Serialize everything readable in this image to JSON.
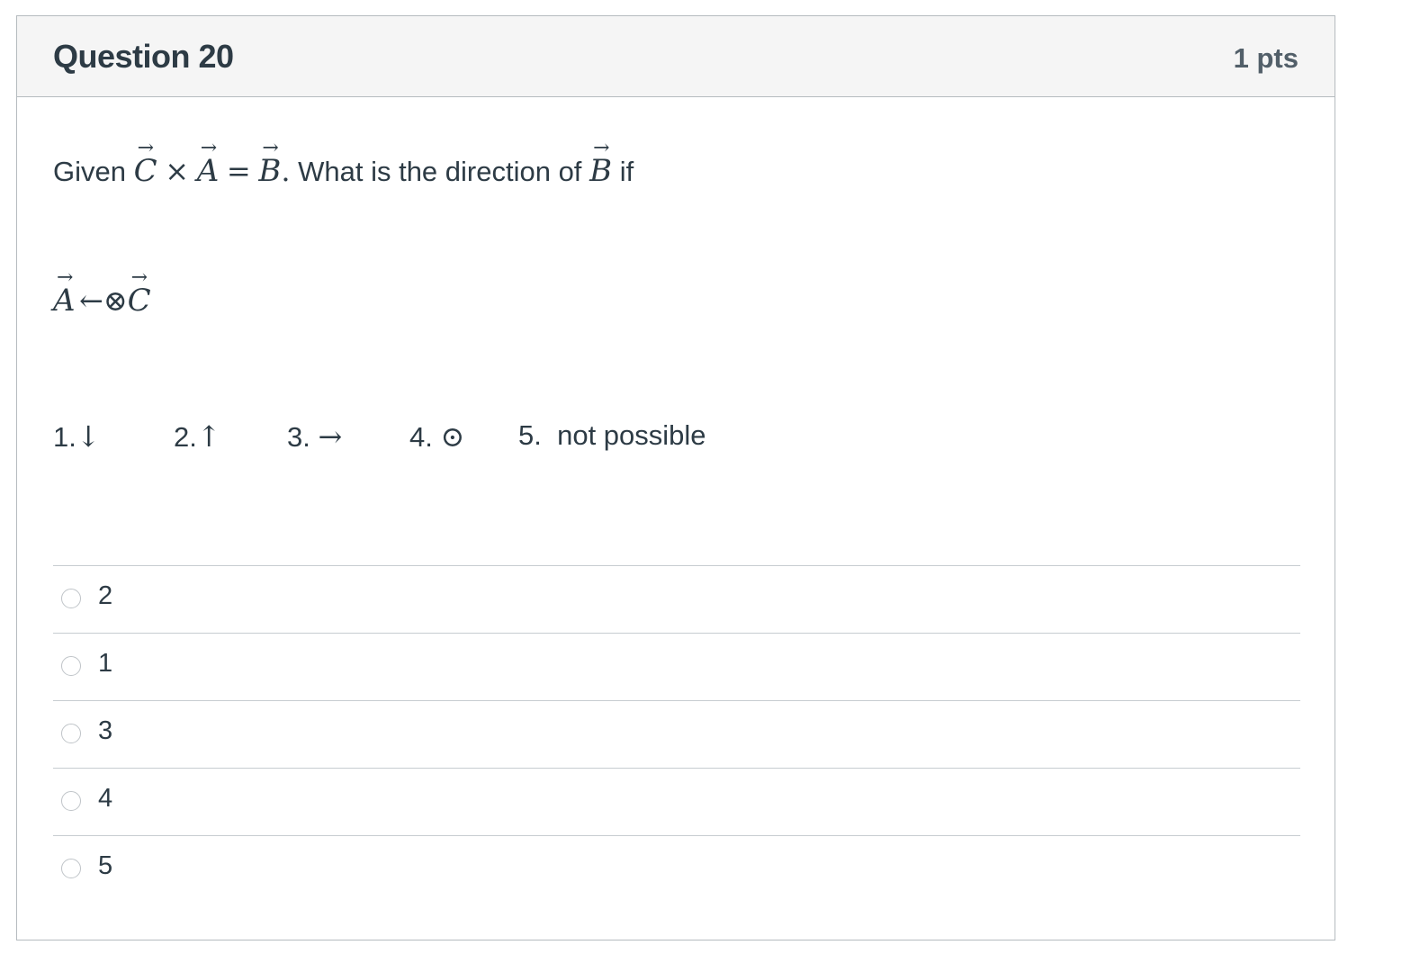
{
  "question": {
    "title": "Question 20",
    "points": "1 pts"
  },
  "prompt": {
    "lead": "Given",
    "equation": {
      "C": "C",
      "times": "×",
      "A": "A",
      "equals": "=",
      "B": "B",
      "period": "."
    },
    "text": "What is the direction of",
    "target": "B",
    "tail": "if"
  },
  "setup": {
    "A": "A",
    "arrow": "←",
    "cross": "⊗",
    "C": "C"
  },
  "choices_legend": [
    {
      "num": "1.",
      "symbol": "↓"
    },
    {
      "num": "2.",
      "symbol": "↑"
    },
    {
      "num": "3.",
      "symbol": "→"
    },
    {
      "num": "4.",
      "symbol": "⊙"
    },
    {
      "num": "5.",
      "symbol": "not possible"
    }
  ],
  "answers": [
    {
      "label": "2"
    },
    {
      "label": "1"
    },
    {
      "label": "3"
    },
    {
      "label": "4"
    },
    {
      "label": "5"
    }
  ]
}
